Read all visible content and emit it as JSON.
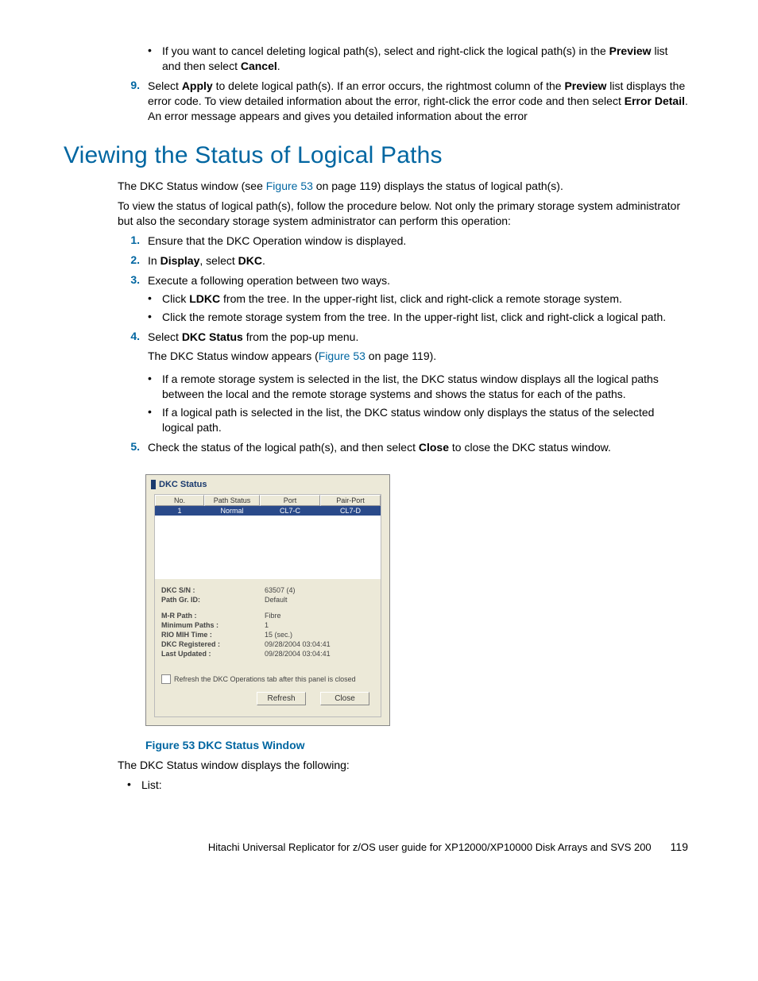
{
  "top": {
    "bullet1_a": "If you want to cancel deleting logical path(s), select and right-click the logical path(s) in the ",
    "bullet1_b": "Preview",
    "bullet1_c": " list and then select ",
    "bullet1_d": "Cancel",
    "bullet1_e": ".",
    "step9_num": "9.",
    "step9_a": "Select ",
    "step9_b": "Apply",
    "step9_c": " to delete logical path(s). If an error occurs, the rightmost column of the ",
    "step9_d": "Preview",
    "step9_e": " list displays the error code. To view detailed information about the error, right-click the error code and then select ",
    "step9_f": "Error Detail",
    "step9_g": ". An error message appears and gives you detailed information about the error"
  },
  "heading": "Viewing the Status of Logical Paths",
  "intro1_a": "The DKC Status window (see ",
  "intro1_link": "Figure 53",
  "intro1_b": " on page 119) displays the status of logical path(s).",
  "intro2": "To view the status of logical path(s), follow the procedure below. Not only the primary storage system administrator but also the secondary storage system administrator can perform this operation:",
  "steps": {
    "s1_num": "1.",
    "s1": "Ensure that the DKC Operation window is displayed.",
    "s2_num": "2.",
    "s2_a": "In ",
    "s2_b": "Display",
    "s2_c": ", select ",
    "s2_d": "DKC",
    "s2_e": ".",
    "s3_num": "3.",
    "s3": "Execute a following operation between two ways.",
    "s3_b1_a": "Click ",
    "s3_b1_b": "LDKC",
    "s3_b1_c": " from the tree. In the upper-right list, click and right-click a remote storage system.",
    "s3_b2": "Click the remote storage system from the tree. In the upper-right list, click and right-click a logical path.",
    "s4_num": "4.",
    "s4_a": "Select ",
    "s4_b": "DKC Status",
    "s4_c": " from the pop-up menu.",
    "s4_p_a": "The DKC Status window appears (",
    "s4_p_link": "Figure 53",
    "s4_p_b": " on page 119).",
    "s4_b1": "If a remote storage system is selected in the list, the DKC status window displays all the logical paths between the local and the remote storage systems and shows the status for each of the paths.",
    "s4_b2": "If a logical path is selected in the list, the DKC status window only displays the status of the selected logical path.",
    "s5_num": "5.",
    "s5_a": "Check the status of the logical path(s), and then select ",
    "s5_b": "Close",
    "s5_c": " to close the DKC status window."
  },
  "dkc": {
    "title": "DKC Status",
    "headers": {
      "no": "No.",
      "path_status": "Path Status",
      "port": "Port",
      "pair_port": "Pair-Port"
    },
    "row": {
      "no": "1",
      "path_status": "Normal",
      "port": "CL7-C",
      "pair_port": "CL7-D"
    },
    "kv": {
      "dkc_sn_k": "DKC S/N :",
      "dkc_sn_v": "63507 (4)",
      "path_gr_k": "Path Gr. ID:",
      "path_gr_v": "Default",
      "mr_k": "M-R Path :",
      "mr_v": "Fibre",
      "min_k": "Minimum Paths :",
      "min_v": "1",
      "rio_k": "RIO MIH Time :",
      "rio_v": "15 (sec.)",
      "reg_k": "DKC Registered :",
      "reg_v": "09/28/2004 03:04:41",
      "upd_k": "Last Updated :",
      "upd_v": "09/28/2004 03:04:41"
    },
    "check_label": "Refresh the DKC Operations tab after this panel is closed",
    "btn_refresh": "Refresh",
    "btn_close": "Close"
  },
  "figure_caption": "Figure 53 DKC Status Window",
  "after_fig": "The DKC Status window displays the following:",
  "after_bullet": "List:",
  "footer_title": "Hitachi Universal Replicator for z/OS user guide for XP12000/XP10000 Disk Arrays and SVS 200",
  "footer_page": "119"
}
